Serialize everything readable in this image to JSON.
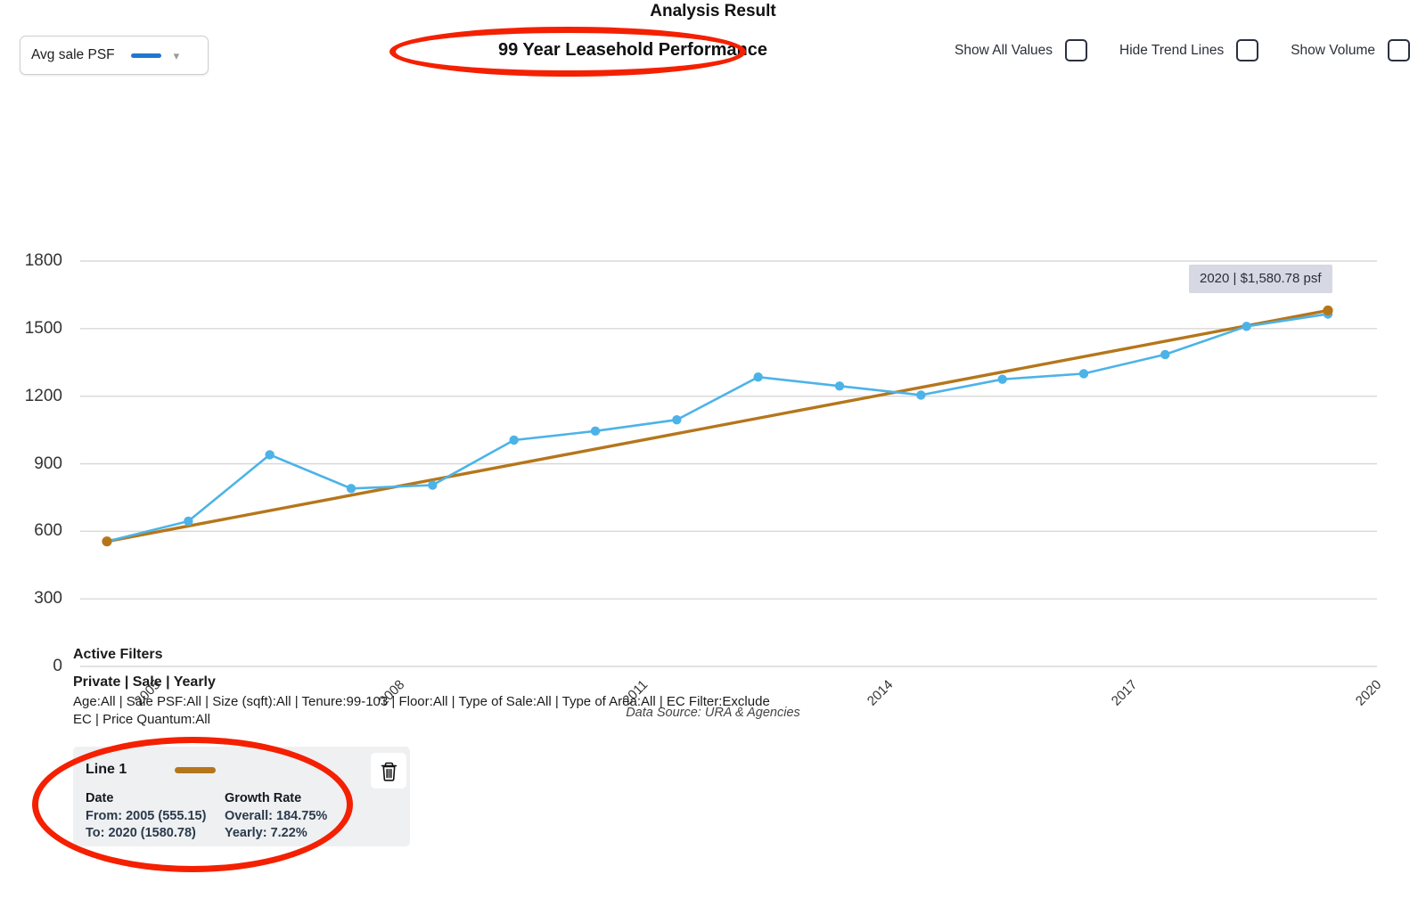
{
  "header": {
    "title": "Analysis Result",
    "subtitle": "99 Year Leasehold Performance"
  },
  "metric_select": {
    "label": "Avg sale PSF",
    "swatch_color": "#1f77d0",
    "chevron": "chevron-down-icon"
  },
  "toggles": [
    {
      "label": "Show All Values",
      "checked": false
    },
    {
      "label": "Hide Trend Lines",
      "checked": false
    },
    {
      "label": "Show Volume",
      "checked": false
    }
  ],
  "tooltip": {
    "text": "2020 | $1,580.78 psf"
  },
  "data_source": "Data Source: URA & Agencies",
  "filters": {
    "title": "Active Filters",
    "primary": "Private | Sale | Yearly",
    "detail": "Age:All | Sale PSF:All | Size (sqft):All | Tenure:99-103 | Floor:All | Type of Sale:All | Type of Area:All | EC Filter:Exclude EC | Price Quantum:All"
  },
  "line_card": {
    "title": "Line 1",
    "swatch_color": "#b5761b",
    "delete_icon": "trash-icon",
    "date_head": "Date",
    "date_from": "From: 2005 (555.15)",
    "date_to": "To: 2020 (1580.78)",
    "growth_head": "Growth Rate",
    "growth_overall": "Overall: 184.75%",
    "growth_yearly": "Yearly: 7.22%"
  },
  "annotations": {
    "highlight_color": "#f42000"
  },
  "chart_data": {
    "type": "line",
    "title": "99 Year Leasehold Performance",
    "xlabel": "",
    "ylabel": "",
    "ylim": [
      0,
      1800
    ],
    "yticks": [
      0,
      300,
      600,
      900,
      1200,
      1500,
      1800
    ],
    "xticks": [
      "2005",
      "2008",
      "2011",
      "2014",
      "2017",
      "2020"
    ],
    "grid": true,
    "legend": "none",
    "x": [
      2005,
      2006,
      2007,
      2008,
      2009,
      2010,
      2011,
      2012,
      2013,
      2014,
      2015,
      2016,
      2017,
      2018,
      2019,
      2020
    ],
    "series": [
      {
        "name": "Avg sale PSF",
        "color": "#4cb3e8",
        "type": "line",
        "values": [
          555.15,
          645,
          940,
          790,
          805,
          1005,
          1045,
          1095,
          1285,
          1245,
          1205,
          1275,
          1300,
          1385,
          1510,
          1565
        ]
      },
      {
        "name": "Line 1 (trend)",
        "color": "#b5761b",
        "type": "trend",
        "values": [
          555.15,
          1580.78
        ],
        "x": [
          2005,
          2020
        ]
      }
    ],
    "annotations": [
      {
        "x": 2020,
        "y": 1580.78,
        "text": "2020 | $1,580.78 psf"
      }
    ]
  }
}
